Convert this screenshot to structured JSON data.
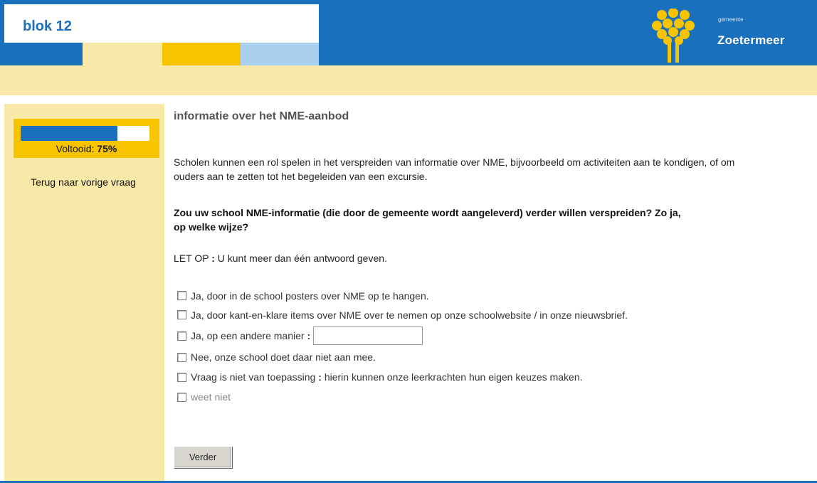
{
  "header": {
    "title": "blok 12",
    "municipality_small": "gemeente",
    "municipality_name": "Zoetermeer",
    "logo_icon": "zoetermeer-flower-logo-icon"
  },
  "colors": {
    "brand_blue": "#1a70bd",
    "light_yellow": "#f9e9a8",
    "yellow": "#f7c400",
    "light_blue": "#a9d0ef"
  },
  "sidebar": {
    "progress_label": "Voltooid:",
    "progress_value": "75%",
    "progress_fraction": 0.75,
    "back_link": "Terug naar vorige vraag"
  },
  "main": {
    "title": "informatie over het NME-aanbod",
    "intro": "Scholen kunnen een rol spelen in het verspreiden van informatie over NME, bijvoorbeeld om activiteiten aan te kondigen, of om ouders aan te zetten tot het begeleiden van een excursie.",
    "question": "Zou uw school NME-informatie (die door de gemeente wordt aangeleverd) verder willen verspreiden? Zo ja, op welke wijze?",
    "note_prefix": "LET OP",
    "note_text": "U kunt meer dan één antwoord geven.",
    "options": [
      "Ja, door in de school posters over NME op te hangen.",
      "Ja, door kant-en-klare items over NME over te nemen op onze schoolwebsite / in onze nieuwsbrief.",
      "Ja, op een andere manier",
      "Nee, onze school doet daar niet aan mee.",
      "Vraag is niet van toepassing",
      "weet niet"
    ],
    "option_other_input_value": "",
    "option_4_detail": "hierin kunnen onze leerkrachten hun eigen keuzes maken.",
    "submit_label": "Verder"
  }
}
